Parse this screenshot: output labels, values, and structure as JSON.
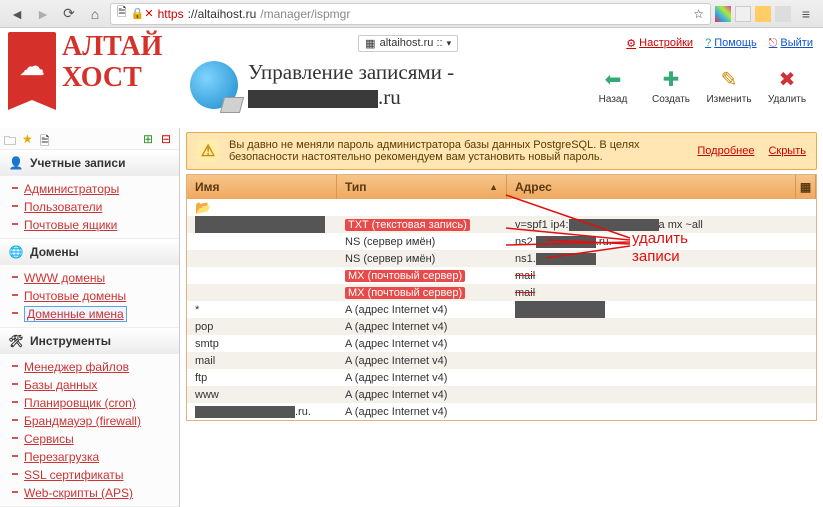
{
  "browser": {
    "url_proto": "https",
    "url_host": "://altaihost.ru",
    "url_path": "/manager/ispmgr"
  },
  "logo": {
    "line1": "АЛТАЙ",
    "line2": "ХОСТ"
  },
  "header": {
    "host_label": "altaihost.ru ::",
    "links": {
      "settings": "Настройки",
      "help": "Помощь",
      "logout": "Выйти"
    },
    "title1": "Управление записями -",
    "title_suffix": ".ru",
    "toolbar": {
      "back": "Назад",
      "create": "Создать",
      "edit": "Изменить",
      "delete": "Удалить"
    }
  },
  "sidebar": {
    "accounts": {
      "title": "Учетные записи",
      "items": [
        "Администраторы",
        "Пользователи",
        "Почтовые ящики"
      ]
    },
    "domains": {
      "title": "Домены",
      "items": [
        "WWW домены",
        "Почтовые домены",
        "Доменные имена"
      ]
    },
    "tools": {
      "title": "Инструменты",
      "items": [
        "Менеджер файлов",
        "Базы данных",
        "Планировщик (cron)",
        "Брандмауэр (firewall)",
        "Сервисы",
        "Перезагрузка",
        "SSL сертификаты",
        "Web-скрипты (APS)"
      ]
    }
  },
  "alert": {
    "text": "Вы давно не меняли пароль администратора базы данных PostgreSQL. В целях безопасности настоятельно рекомендуем вам установить новый пароль.",
    "more": "Подробнее",
    "hide": "Скрыть"
  },
  "grid": {
    "columns": {
      "name": "Имя",
      "type": "Тип",
      "addr": "Адрес"
    },
    "rows": [
      {
        "name": "__redact_big",
        "type_hl": "TXT (текстовая запись)",
        "addr_pre": "v=spf1 ip4:",
        "addr_mid_redact": 90,
        "addr_post": "a mx ~all"
      },
      {
        "name": "",
        "type": "NS (сервер имён)",
        "addr_pre": "ns2.",
        "addr_mid_redact": 60,
        "addr_post": ".ru."
      },
      {
        "name": "",
        "type": "NS (сервер имён)",
        "addr_pre": "ns1.",
        "addr_mid_redact": 60,
        "addr_post": ""
      },
      {
        "name": "",
        "type_hl": "MX (почтовый сервер)",
        "addr_pre": "mail",
        "strike": true
      },
      {
        "name": "",
        "type_hl": "MX (почтовый сервер)",
        "addr_pre": "mail",
        "strike": true
      },
      {
        "name": "*",
        "type": "A (адрес Internet v4)",
        "addr_redact_box": true
      },
      {
        "name": "pop",
        "type": "A (адрес Internet v4)"
      },
      {
        "name": "smtp",
        "type": "A (адрес Internet v4)"
      },
      {
        "name": "mail",
        "type": "A (адрес Internet v4)"
      },
      {
        "name": "ftp",
        "type": "A (адрес Internet v4)"
      },
      {
        "name": "www",
        "type": "A (адрес Internet v4)"
      },
      {
        "name": "__redact_small",
        "name_suffix": ".ru.",
        "type": "A (адрес Internet v4)"
      }
    ]
  },
  "annotation": {
    "text1": "удалить",
    "text2": "записи"
  }
}
